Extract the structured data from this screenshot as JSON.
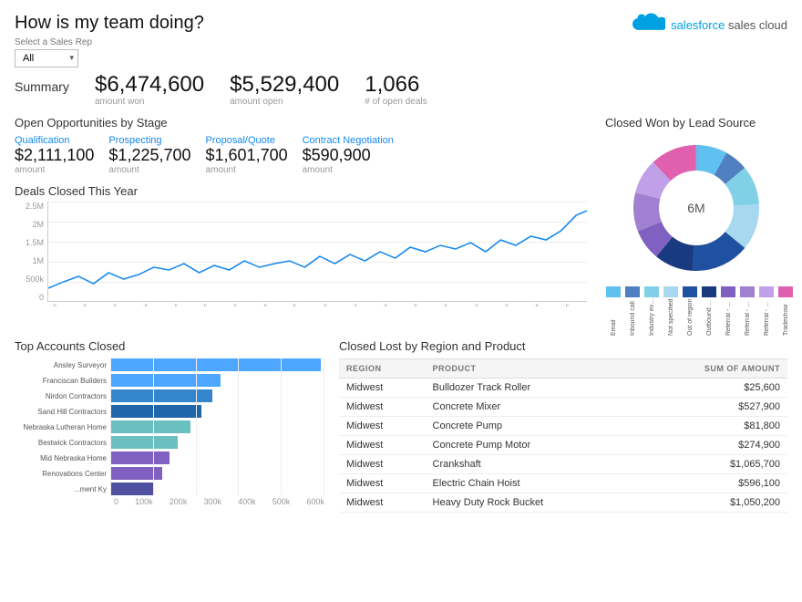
{
  "header": {
    "title": "How is my team doing?",
    "sales_rep_label": "Select a Sales Rep",
    "sales_rep_value": "All"
  },
  "logo": {
    "brand": "salesforce",
    "product": "sales cloud"
  },
  "summary": {
    "label": "Summary",
    "items": [
      {
        "value": "$6,474,600",
        "label": "amount won"
      },
      {
        "value": "$5,529,400",
        "label": "amount open"
      },
      {
        "value": "1,066",
        "label": "# of open deals"
      }
    ]
  },
  "open_opps": {
    "title": "Open Opportunities by Stage",
    "stages": [
      {
        "name": "Qualification",
        "amount": "$2,111,100",
        "label": "amount"
      },
      {
        "name": "Prospecting",
        "amount": "$1,225,700",
        "label": "amount"
      },
      {
        "name": "Proposal/Quote",
        "amount": "$1,601,700",
        "label": "amount"
      },
      {
        "name": "Contract Negotiation",
        "amount": "$590,900",
        "label": "amount"
      }
    ]
  },
  "deals_chart": {
    "title": "Deals Closed This Year",
    "y_labels": [
      "2.5M",
      "2M",
      "1.5M",
      "1M",
      "500k",
      "0"
    ],
    "x_labels": [
      "2010-01",
      "2010-04",
      "2010-07",
      "2010-10",
      "2011-01",
      "2011-04",
      "2011-07",
      "2011-10",
      "2012-01",
      "2012-04",
      "2012-07",
      "2012-10",
      "2013-01",
      "2013-04",
      "2013-07",
      "2013-10",
      "2014-01",
      "2014-04"
    ]
  },
  "donut": {
    "title": "Closed Won by Lead Source",
    "center_text": "6M",
    "segments": [
      {
        "label": "Email",
        "color": "#60c0f0",
        "pct": 8
      },
      {
        "label": "Inbound call",
        "color": "#5080c0",
        "pct": 6
      },
      {
        "label": "Industry event",
        "color": "#80d0e8",
        "pct": 10
      },
      {
        "label": "Not specified",
        "color": "#a8d8f0",
        "pct": 12
      },
      {
        "label": "Out of region",
        "color": "#2050a0",
        "pct": 15
      },
      {
        "label": "Outbound call",
        "color": "#1a3a80",
        "pct": 10
      },
      {
        "label": "Referral - Staff",
        "color": "#8060c0",
        "pct": 8
      },
      {
        "label": "Referral - Customer",
        "color": "#a080d0",
        "pct": 10
      },
      {
        "label": "Referral - Partner",
        "color": "#c0a0e8",
        "pct": 9
      },
      {
        "label": "Tradeshow",
        "color": "#e060b0",
        "pct": 12
      }
    ]
  },
  "top_accounts": {
    "title": "Top Accounts Closed",
    "accounts": [
      {
        "name": "Ansley Surveyor",
        "value": 590,
        "color": "#4da6ff"
      },
      {
        "name": "Franciscan Builders",
        "value": 310,
        "color": "#4da6ff"
      },
      {
        "name": "Nirdon Contractors",
        "value": 285,
        "color": "#3385cc"
      },
      {
        "name": "Sand Hill Contractors",
        "value": 255,
        "color": "#2266aa"
      },
      {
        "name": "Nebraska Lutheran Home",
        "value": 225,
        "color": "#6abfbf"
      },
      {
        "name": "Bestwick Contractors",
        "value": 190,
        "color": "#6abfbf"
      },
      {
        "name": "Mid Nebraska Home",
        "value": 165,
        "color": "#8060c0"
      },
      {
        "name": "Renovations Center",
        "value": 145,
        "color": "#8060c0"
      },
      {
        "name": "...ment Ky",
        "value": 120,
        "color": "#5050a0"
      }
    ],
    "x_ticks": [
      "0",
      "100k",
      "200k",
      "300k",
      "400k",
      "500k",
      "600k"
    ]
  },
  "closed_lost": {
    "title": "Closed Lost by Region and Product",
    "columns": [
      "Region",
      "Product",
      "Sum of Amount"
    ],
    "rows": [
      {
        "region": "Midwest",
        "product": "Bulldozer Track Roller",
        "amount": "$25,600"
      },
      {
        "region": "Midwest",
        "product": "Concrete Mixer",
        "amount": "$527,900"
      },
      {
        "region": "Midwest",
        "product": "Concrete Pump",
        "amount": "$81,800"
      },
      {
        "region": "Midwest",
        "product": "Concrete Pump Motor",
        "amount": "$274,900"
      },
      {
        "region": "Midwest",
        "product": "Crankshaft",
        "amount": "$1,065,700"
      },
      {
        "region": "Midwest",
        "product": "Electric Chain Hoist",
        "amount": "$596,100"
      },
      {
        "region": "Midwest",
        "product": "Heavy Duty Rock Bucket",
        "amount": "$1,050,200"
      }
    ]
  }
}
